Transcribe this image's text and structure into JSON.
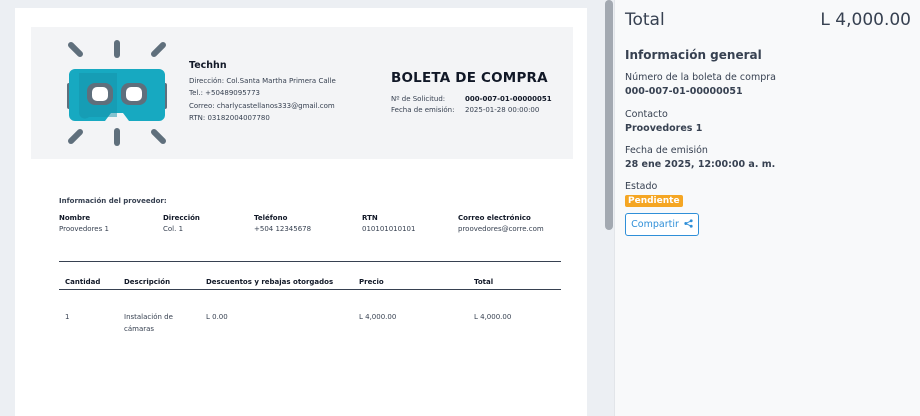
{
  "company": {
    "name": "Techhn",
    "address_label": "Dirección:",
    "address": "Col.Santa Martha Primera Calle",
    "phone_label": "Tel.:",
    "phone": "+50489095773",
    "email_label": "Correo:",
    "email": "charlycastellanos333@gmail.com",
    "rtn_label": "RTN:",
    "rtn": "03182004007780"
  },
  "document": {
    "title": "BOLETA DE COMPRA",
    "request_label": "Nº de Solicitud:",
    "request_number": "000-007-01-00000051",
    "issue_label": "Fecha de emisión:",
    "issue_date": "2025-01-28 00:00:00"
  },
  "provider": {
    "section_title": "Información del proveedor:",
    "columns": [
      {
        "header": "Nombre",
        "value": "Proovedores 1"
      },
      {
        "header": "Dirección",
        "value": "Col. 1"
      },
      {
        "header": "Teléfono",
        "value": "+504 12345678"
      },
      {
        "header": "RTN",
        "value": "010101010101"
      },
      {
        "header": "Correo electrónico",
        "value": "proovedores@corre.com"
      }
    ]
  },
  "items_table": {
    "headers": [
      "Cantidad",
      "Descripción",
      "Descuentos y rebajas otorgados",
      "Precio",
      "Total"
    ],
    "rows": [
      {
        "qty": "1",
        "desc_line1": "Instalación de",
        "desc_line2": "cámaras",
        "discount": "L 0.00",
        "price": "L 4,000.00",
        "total": "L 4,000.00"
      }
    ]
  },
  "sidebar": {
    "total_label": "Total",
    "total_amount": "L 4,000.00",
    "section_title": "Información general",
    "fields": [
      {
        "label": "Número de la boleta de compra",
        "value": "000-007-01-00000051"
      },
      {
        "label": "Contacto",
        "value": "Proovedores 1"
      },
      {
        "label": "Fecha de emisión",
        "value": "28 ene 2025, 12:00:00 a. m."
      }
    ],
    "status_label": "Estado",
    "status_value": "Pendiente",
    "share_label": "Compartir"
  },
  "colors": {
    "accent": "#2f8fd8",
    "badge": "#f5a623",
    "logo_teal": "#17a9c1",
    "logo_gray": "#5f6f7c"
  },
  "icons": [
    "vr-headset-logo-icon",
    "share-icon"
  ]
}
